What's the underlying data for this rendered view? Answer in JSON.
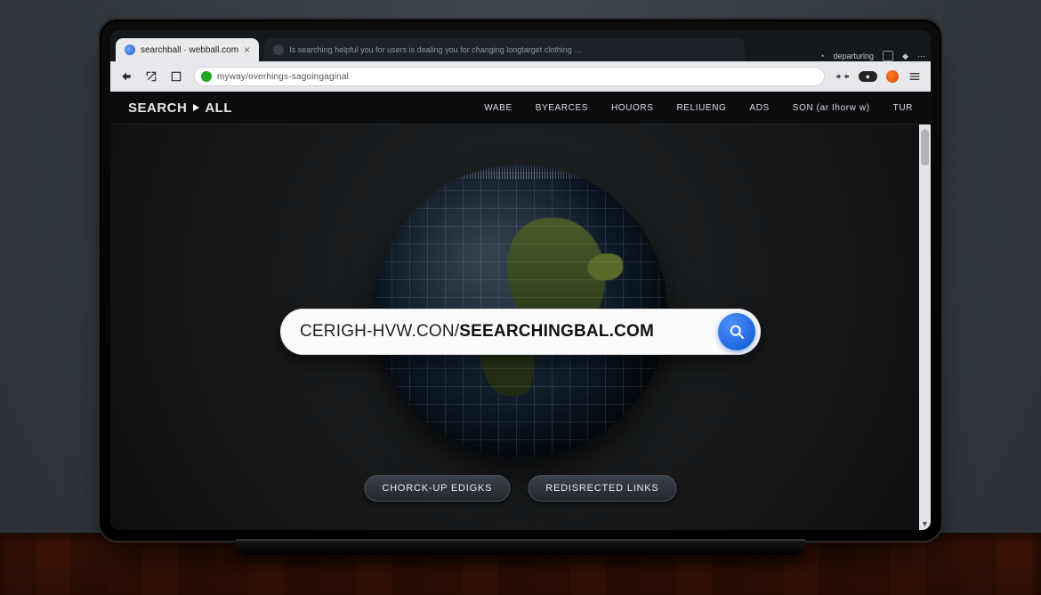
{
  "browser": {
    "tabs": [
      {
        "favicon": "globe-icon",
        "title": "searchball · webball.com",
        "active": true
      },
      {
        "favicon": "page-icon",
        "title": "Is searching helpful you for users is dealing you for changing longtarget clothing …",
        "active": false
      }
    ],
    "toolbarText": "departuring",
    "url": "myway/overhings-sagoingaginal"
  },
  "site": {
    "brand": "SEARCHBALL",
    "nav": [
      "WABE",
      "BYEARCES",
      "HOUORS",
      "RELIUENG",
      "ADS",
      "SON (ar Ihorw w)",
      "TUR"
    ]
  },
  "search": {
    "value_prefix": "CERIGH-HVW.CON/",
    "value_main": "SEEARCHINGBAL.COM"
  },
  "pills": [
    "CHORCK-UP EDIGKS",
    "REDISRECTED LINKS"
  ]
}
